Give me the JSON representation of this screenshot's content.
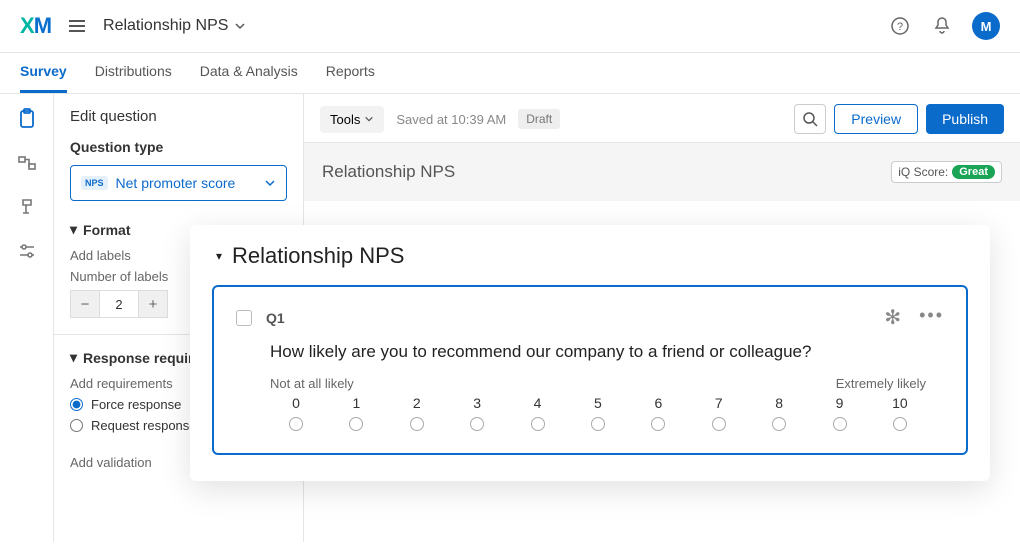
{
  "header": {
    "logo": {
      "x": "X",
      "m": "M"
    },
    "project_name": "Relationship NPS",
    "avatar_letter": "M"
  },
  "tabs": [
    {
      "label": "Survey",
      "active": true
    },
    {
      "label": "Distributions",
      "active": false
    },
    {
      "label": "Data & Analysis",
      "active": false
    },
    {
      "label": "Reports",
      "active": false
    }
  ],
  "left_panel": {
    "title": "Edit question",
    "question_type_label": "Question type",
    "qtype_badge": "NPS",
    "qtype_value": "Net promoter score",
    "format_label": "Format",
    "add_labels_label": "Add labels",
    "num_labels_label": "Number of labels",
    "num_labels_value": "2",
    "response_req_label": "Response requirements",
    "add_requirements_label": "Add requirements",
    "force_response_label": "Force response",
    "request_response_label": "Request response",
    "add_validation_label": "Add validation"
  },
  "canvas": {
    "tools_btn": "Tools",
    "saved_text": "Saved at 10:39 AM",
    "draft_label": "Draft",
    "preview_btn": "Preview",
    "publish_btn": "Publish",
    "block_title": "Relationship NPS",
    "iq_score_label": "iQ Score:",
    "iq_score_value": "Great"
  },
  "overlay": {
    "heading": "Relationship NPS",
    "qnum": "Q1",
    "qtext": "How likely are you to recommend our company to a friend or colleague?",
    "label_low": "Not at all likely",
    "label_high": "Extremely likely",
    "scale": [
      "0",
      "1",
      "2",
      "3",
      "4",
      "5",
      "6",
      "7",
      "8",
      "9",
      "10"
    ]
  }
}
